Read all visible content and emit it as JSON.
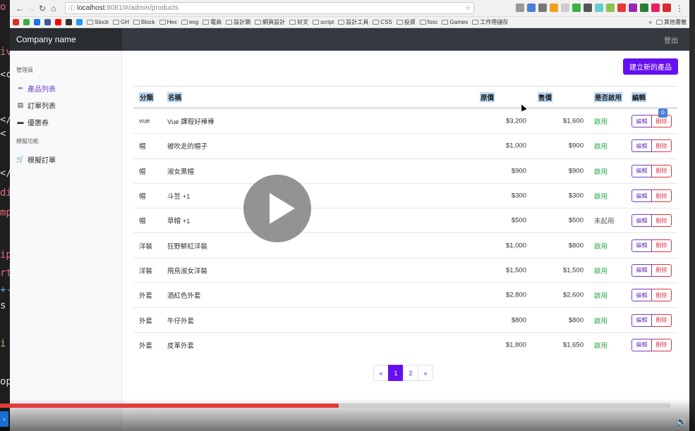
{
  "browser": {
    "url_host": "localhost",
    "url_rest": ":8081/#/admin/products",
    "bookmarks": [
      "Stock",
      "GH",
      "Block",
      "Hex",
      "eng",
      "電商",
      "設計類",
      "網頁設計",
      "好文",
      "script",
      "設計工具",
      "CSS",
      "投資",
      "foxc",
      "Games",
      "工作用儲存"
    ],
    "bookmarks_more": "»",
    "other_bookmarks": "其他書籤"
  },
  "app": {
    "brand": "Company name",
    "logout": "登出"
  },
  "sidebar": {
    "section1": "管理員",
    "items1": [
      {
        "label": "產品列表",
        "icon": "boxes-icon"
      },
      {
        "label": "訂單列表",
        "icon": "list-icon"
      },
      {
        "label": "優惠券",
        "icon": "ticket-icon"
      }
    ],
    "section2": "模擬功能",
    "items2": [
      {
        "label": "模擬訂單",
        "icon": "cart-icon"
      }
    ]
  },
  "main": {
    "create_button": "建立新的產品",
    "columns": [
      "分類",
      "名稱",
      "原價",
      "售價",
      "是否啟用",
      "編輯"
    ],
    "edit_label": "編輯",
    "delete_label": "刪除",
    "rows": [
      {
        "category": "vue",
        "name": "Vue 課程好棒棒",
        "origin_price": "$3,200",
        "price": "$1,600",
        "enabled": "啟用",
        "is_enabled": true
      },
      {
        "category": "帽",
        "name": "被吹走的帽子",
        "origin_price": "$1,000",
        "price": "$900",
        "enabled": "啟用",
        "is_enabled": true
      },
      {
        "category": "帽",
        "name": "淑女黑帽",
        "origin_price": "$900",
        "price": "$900",
        "enabled": "啟用",
        "is_enabled": true
      },
      {
        "category": "帽",
        "name": "斗笠 +1",
        "origin_price": "$300",
        "price": "$300",
        "enabled": "啟用",
        "is_enabled": true
      },
      {
        "category": "帽",
        "name": "草帽 +1",
        "origin_price": "$500",
        "price": "$500",
        "enabled": "未起用",
        "is_enabled": false
      },
      {
        "category": "洋裝",
        "name": "狂野鮮紅洋裝",
        "origin_price": "$1,000",
        "price": "$800",
        "enabled": "啟用",
        "is_enabled": true
      },
      {
        "category": "洋裝",
        "name": "飛鳥淑女洋裝",
        "origin_price": "$1,500",
        "price": "$1,500",
        "enabled": "啟用",
        "is_enabled": true
      },
      {
        "category": "外套",
        "name": "酒紅色外套",
        "origin_price": "$2,800",
        "price": "$2,600",
        "enabled": "啟用",
        "is_enabled": true
      },
      {
        "category": "外套",
        "name": "牛仔外套",
        "origin_price": "$800",
        "price": "$800",
        "enabled": "啟用",
        "is_enabled": true
      },
      {
        "category": "外套",
        "name": "皮革外套",
        "origin_price": "$1,800",
        "price": "$1,650",
        "enabled": "啟用",
        "is_enabled": true
      }
    ],
    "pagination": {
      "prev": "«",
      "pages": [
        "1",
        "2"
      ],
      "current": "1",
      "next": "»"
    }
  },
  "video": {
    "progress": 0.505,
    "colors": {
      "progress": "#e53b3b",
      "accent": "#6610f2"
    }
  }
}
